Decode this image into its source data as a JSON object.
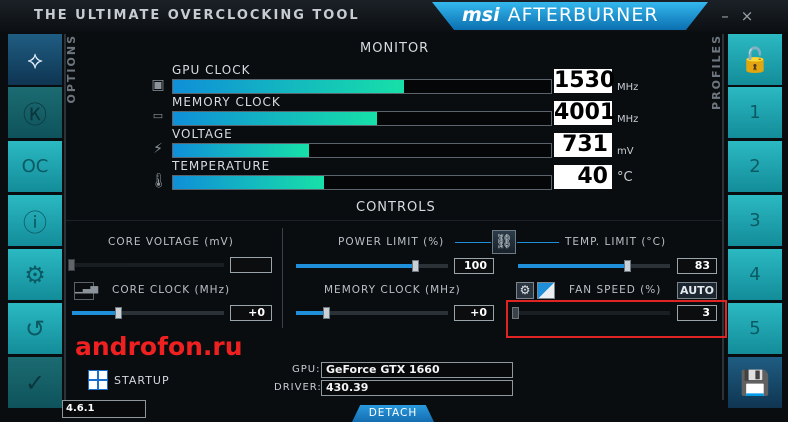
{
  "window": {
    "title": "THE ULTIMATE OVERCLOCKING TOOL",
    "brand_msi": "msi",
    "brand_name": "AFTERBURNER",
    "minimize_label": "–",
    "close_label": "×"
  },
  "left_sidebar": {
    "vertical_label": "OPTIONS",
    "buttons": [
      {
        "name": "msi-dragon",
        "glyph": "⟡"
      },
      {
        "name": "kombustor",
        "glyph": "Ⓚ"
      },
      {
        "name": "oc-scanner",
        "glyph": "OC"
      },
      {
        "name": "info",
        "glyph": "ⓘ"
      },
      {
        "name": "settings",
        "glyph": "⚙"
      },
      {
        "name": "reset",
        "glyph": "↺"
      },
      {
        "name": "apply",
        "glyph": "✓"
      }
    ]
  },
  "right_sidebar": {
    "vertical_label": "PROFILES",
    "buttons": [
      {
        "name": "lock",
        "glyph": "🔓"
      },
      {
        "name": "profile-1",
        "glyph": "1"
      },
      {
        "name": "profile-2",
        "glyph": "2"
      },
      {
        "name": "profile-3",
        "glyph": "3"
      },
      {
        "name": "profile-4",
        "glyph": "4"
      },
      {
        "name": "profile-5",
        "glyph": "5"
      },
      {
        "name": "save",
        "glyph": "💾"
      }
    ]
  },
  "monitor": {
    "section_title": "MONITOR",
    "items": [
      {
        "label": "GPU CLOCK",
        "value": "1530",
        "unit": "MHz",
        "fill": 0.61
      },
      {
        "label": "MEMORY CLOCK",
        "value": "4001",
        "unit": "MHz",
        "fill": 0.54
      },
      {
        "label": "VOLTAGE",
        "value": "731",
        "unit": "mV",
        "fill": 0.36
      },
      {
        "label": "TEMPERATURE",
        "value": "40",
        "unit": "°C",
        "fill": 0.4
      }
    ]
  },
  "controls": {
    "section_title": "CONTROLS",
    "core_voltage": {
      "label": "CORE VOLTAGE (mV)",
      "value": ""
    },
    "core_clock": {
      "label": "CORE CLOCK (MHz)",
      "value": "+0",
      "fill": 0.3
    },
    "power_limit": {
      "label": "POWER LIMIT (%)",
      "value": "100",
      "fill": 0.78
    },
    "memory_clock": {
      "label": "MEMORY CLOCK (MHz)",
      "value": "+0",
      "fill": 0.2
    },
    "temp_limit": {
      "label": "TEMP. LIMIT (°C)",
      "value": "83",
      "fill": 0.72
    },
    "fan_speed": {
      "label": "FAN SPEED (%)",
      "value": "3",
      "auto_label": "AUTO",
      "fill": 0.0
    }
  },
  "info": {
    "gpu_label": "GPU:",
    "gpu_value": "GeForce GTX 1660",
    "driver_label": "DRIVER:",
    "driver_value": "430.39"
  },
  "footer": {
    "startup_label": "STARTUP",
    "detach_label": "DETACH",
    "version": "4.6.1"
  },
  "watermark": "androfon.ru",
  "colors": {
    "accent_blue": "#1e8fd8",
    "side_teal": "#2bb9c2",
    "highlight_red": "#e02424"
  }
}
